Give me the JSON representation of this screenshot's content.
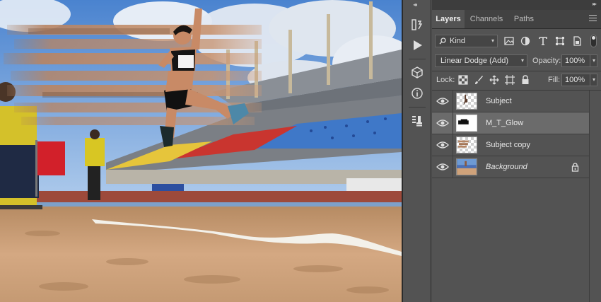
{
  "canvas": {
    "description_icon": "photo-long-jump-athlete"
  },
  "toolstrip": {
    "collapse_glyph": "◂◂",
    "tools": [
      {
        "name": "history-icon"
      },
      {
        "name": "play-actions-icon"
      },
      {
        "name": "3d-cube-icon"
      },
      {
        "name": "info-icon"
      },
      {
        "name": "clone-source-icon"
      }
    ]
  },
  "panel": {
    "collapse_glyph": "▸▸",
    "tabs": [
      {
        "label": "Layers",
        "active": true
      },
      {
        "label": "Channels",
        "active": false
      },
      {
        "label": "Paths",
        "active": false
      }
    ],
    "filter": {
      "kind_label": "Kind",
      "filter_icons": [
        "image-filter-icon",
        "adjustment-filter-icon",
        "type-filter-icon",
        "shape-filter-icon",
        "smart-object-filter-icon"
      ]
    },
    "blend": {
      "mode": "Linear Dodge (Add)",
      "opacity_label": "Opacity:",
      "opacity_value": "100%"
    },
    "lock": {
      "label": "Lock:",
      "fill_label": "Fill:",
      "fill_value": "100%"
    },
    "layers": [
      {
        "name": "Subject",
        "visible": true,
        "selected": false,
        "italic": false,
        "locked": false
      },
      {
        "name": "M_T_Glow",
        "visible": true,
        "selected": true,
        "italic": false,
        "locked": false
      },
      {
        "name": "Subject copy",
        "visible": true,
        "selected": false,
        "italic": false,
        "locked": false
      },
      {
        "name": "Background",
        "visible": true,
        "selected": false,
        "italic": true,
        "locked": true
      }
    ]
  },
  "colors": {
    "panel_bg": "#535353",
    "selected_row": "#6b6b6b",
    "sky": "#5e8fd0",
    "sand": "#cfa27a",
    "seats_blue": "#3f78c8",
    "seats_red": "#c9352f",
    "seats_yellow": "#e6c53b"
  }
}
